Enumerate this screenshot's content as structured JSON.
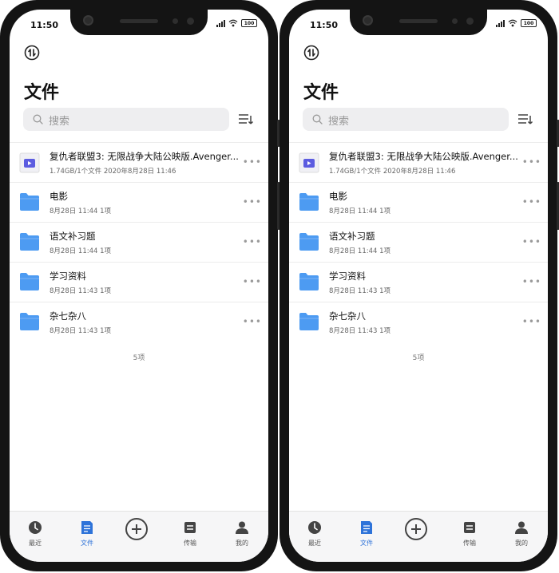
{
  "status": {
    "time": "11:50",
    "battery": "100"
  },
  "header": {
    "title": "文件"
  },
  "search": {
    "placeholder": "搜索"
  },
  "files": [
    {
      "type": "video",
      "name": "复仇者联盟3: 无限战争大陆公映版.Avenger...",
      "meta": "1.74GB/1个文件   2020年8月28日 11:46"
    },
    {
      "type": "folder",
      "name": "电影",
      "meta": "8月28日 11:44   1项"
    },
    {
      "type": "folder",
      "name": "语文补习题",
      "meta": "8月28日 11:44   1项"
    },
    {
      "type": "folder",
      "name": "学习资料",
      "meta": "8月28日 11:43   1项"
    },
    {
      "type": "folder",
      "name": "杂七杂八",
      "meta": "8月28日 11:43   1项"
    }
  ],
  "more_label": "•••",
  "item_count": "5项",
  "tabs": [
    {
      "label": "最近",
      "icon": "clock-icon"
    },
    {
      "label": "文件",
      "icon": "file-icon",
      "active": true
    },
    {
      "label": "",
      "icon": "add-icon"
    },
    {
      "label": "传输",
      "icon": "transfer-icon"
    },
    {
      "label": "我的",
      "icon": "user-icon"
    }
  ],
  "colors": {
    "folder": "#4d9bf2",
    "accent": "#2e73d9",
    "video": "#5c5ce0"
  }
}
